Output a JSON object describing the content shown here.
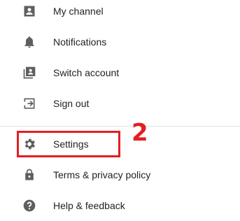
{
  "menu": {
    "items": [
      {
        "label": "My channel",
        "icon": "account-box-icon"
      },
      {
        "label": "Notifications",
        "icon": "bell-icon"
      },
      {
        "label": "Switch account",
        "icon": "switch-account-icon"
      },
      {
        "label": "Sign out",
        "icon": "sign-out-icon"
      },
      {
        "label": "Settings",
        "icon": "gear-icon"
      },
      {
        "label": "Terms & privacy policy",
        "icon": "lock-icon"
      },
      {
        "label": "Help & feedback",
        "icon": "help-icon"
      }
    ]
  },
  "annotation": {
    "step_number": "2",
    "color": "#e31e24"
  },
  "colors": {
    "icon": "#5f5f5f",
    "text": "#1f1f1f"
  }
}
